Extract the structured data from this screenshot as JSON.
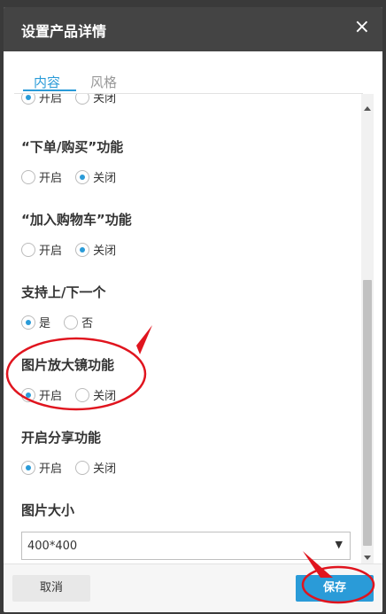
{
  "dialog": {
    "title": "设置产品详情",
    "close_symbol": "×"
  },
  "tabs": [
    {
      "label": "内容"
    },
    {
      "label": "风格"
    }
  ],
  "sections": [
    {
      "label": "",
      "options": [
        {
          "label": "开启",
          "checked": true
        },
        {
          "label": "关闭",
          "checked": false
        }
      ]
    },
    {
      "label": "“下单/购买”功能",
      "options": [
        {
          "label": "开启",
          "checked": false
        },
        {
          "label": "关闭",
          "checked": true
        }
      ]
    },
    {
      "label": "“加入购物车”功能",
      "options": [
        {
          "label": "开启",
          "checked": false
        },
        {
          "label": "关闭",
          "checked": true
        }
      ]
    },
    {
      "label": "支持上/下一个",
      "options": [
        {
          "label": "是",
          "checked": true
        },
        {
          "label": "否",
          "checked": false
        }
      ]
    },
    {
      "label": "图片放大镜功能",
      "options": [
        {
          "label": "开启",
          "checked": true
        },
        {
          "label": "关闭",
          "checked": false
        }
      ]
    },
    {
      "label": "开启分享功能",
      "options": [
        {
          "label": "开启",
          "checked": true
        },
        {
          "label": "关闭",
          "checked": false
        }
      ]
    }
  ],
  "image_size": {
    "label": "图片大小",
    "selected": "400*400",
    "arrow": "▼"
  },
  "footer": {
    "cancel_label": "取消",
    "save_label": "保存"
  },
  "colors": {
    "accent": "#2a9bd8",
    "header_bg": "#444444",
    "annotation": "#e0141e"
  }
}
